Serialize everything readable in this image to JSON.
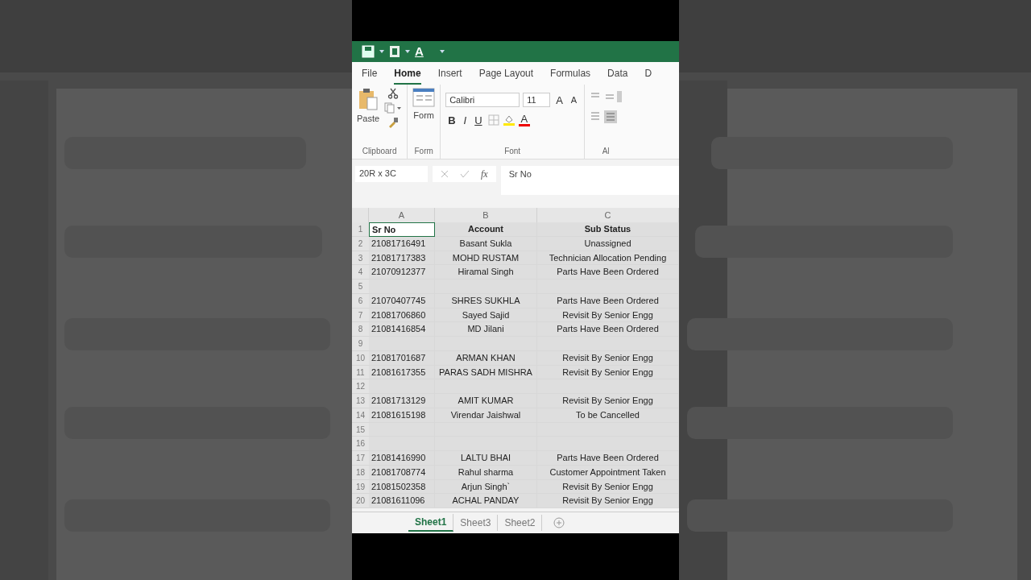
{
  "quick_access": {
    "text_icon": "A"
  },
  "ribbon_tabs": [
    {
      "label": "File",
      "selected": false
    },
    {
      "label": "Home",
      "selected": true
    },
    {
      "label": "Insert",
      "selected": false
    },
    {
      "label": "Page Layout",
      "selected": false
    },
    {
      "label": "Formulas",
      "selected": false
    },
    {
      "label": "Data",
      "selected": false
    },
    {
      "label": "D",
      "selected": false
    }
  ],
  "ribbon": {
    "clipboard": {
      "paste": "Paste",
      "label": "Clipboard"
    },
    "form": {
      "button": "Form",
      "label": "Form"
    },
    "font": {
      "name": "Calibri",
      "size": "11",
      "grow": "A",
      "shrink": "A",
      "bold": "B",
      "italic": "I",
      "underline": "U",
      "color_letter": "A",
      "label": "Font"
    },
    "alignment": {
      "label": "Al"
    }
  },
  "formula_bar": {
    "name_box": "20R x 3C",
    "function_label": "fx",
    "value": "Sr No"
  },
  "columns": [
    "A",
    "B",
    "C"
  ],
  "rows": [
    {
      "number": "1",
      "selected": true,
      "kind": "header",
      "cells": [
        {
          "text": "Sr No",
          "selected": true
        },
        {
          "text": "Account",
          "selected": false
        },
        {
          "text": "Sub Status",
          "selected": false
        }
      ]
    },
    {
      "number": "2",
      "selected": true,
      "kind": "data",
      "cells": [
        {
          "text": "21081716491",
          "selected": false
        },
        {
          "text": "Basant Sukla",
          "selected": false
        },
        {
          "text": "Unassigned",
          "selected": false
        }
      ]
    },
    {
      "number": "3",
      "selected": true,
      "kind": "data",
      "cells": [
        {
          "text": "21081717383",
          "selected": false
        },
        {
          "text": "MOHD RUSTAM",
          "selected": false
        },
        {
          "text": "Technician Allocation Pending",
          "selected": false
        }
      ]
    },
    {
      "number": "4",
      "selected": true,
      "kind": "data",
      "cells": [
        {
          "text": "21070912377",
          "selected": false
        },
        {
          "text": "Hiramal Singh",
          "selected": false
        },
        {
          "text": "Parts Have Been Ordered",
          "selected": false
        }
      ]
    },
    {
      "number": "5",
      "selected": true,
      "kind": "data",
      "cells": []
    },
    {
      "number": "6",
      "selected": true,
      "kind": "data",
      "cells": [
        {
          "text": "21070407745",
          "selected": false
        },
        {
          "text": "SHRES SUKHLA",
          "selected": false
        },
        {
          "text": "Parts Have Been Ordered",
          "selected": false
        }
      ]
    },
    {
      "number": "7",
      "selected": true,
      "kind": "data",
      "cells": [
        {
          "text": "21081706860",
          "selected": false
        },
        {
          "text": "Sayed Sajid",
          "selected": false
        },
        {
          "text": "Revisit By Senior Engg",
          "selected": false
        }
      ]
    },
    {
      "number": "8",
      "selected": true,
      "kind": "data",
      "cells": [
        {
          "text": "21081416854",
          "selected": false
        },
        {
          "text": "MD Jilani",
          "selected": false
        },
        {
          "text": "Parts Have Been Ordered",
          "selected": false
        }
      ]
    },
    {
      "number": "9",
      "selected": true,
      "kind": "data",
      "cells": []
    },
    {
      "number": "10",
      "selected": true,
      "kind": "data",
      "cells": [
        {
          "text": "21081701687",
          "selected": false
        },
        {
          "text": "ARMAN KHAN",
          "selected": false
        },
        {
          "text": "Revisit By Senior Engg",
          "selected": false
        }
      ]
    },
    {
      "number": "11",
      "selected": true,
      "kind": "data",
      "cells": [
        {
          "text": "21081617355",
          "selected": false
        },
        {
          "text": "PARAS SADH MISHRA",
          "selected": false
        },
        {
          "text": "Revisit By Senior Engg",
          "selected": false
        }
      ]
    },
    {
      "number": "12",
      "selected": true,
      "kind": "data",
      "cells": []
    },
    {
      "number": "13",
      "selected": true,
      "kind": "data",
      "cells": [
        {
          "text": "21081713129",
          "selected": false
        },
        {
          "text": "AMIT KUMAR",
          "selected": false
        },
        {
          "text": "Revisit By Senior Engg",
          "selected": false
        }
      ]
    },
    {
      "number": "14",
      "selected": true,
      "kind": "data",
      "cells": [
        {
          "text": "21081615198",
          "selected": false
        },
        {
          "text": "Virendar Jaishwal",
          "selected": false
        },
        {
          "text": "To be Cancelled",
          "selected": false
        }
      ]
    },
    {
      "number": "15",
      "selected": true,
      "kind": "data",
      "cells": []
    },
    {
      "number": "16",
      "selected": true,
      "kind": "data",
      "cells": []
    },
    {
      "number": "17",
      "selected": true,
      "kind": "data",
      "cells": [
        {
          "text": "21081416990",
          "selected": false
        },
        {
          "text": "LALTU BHAI",
          "selected": false
        },
        {
          "text": "Parts Have Been Ordered",
          "selected": false
        }
      ]
    },
    {
      "number": "18",
      "selected": true,
      "kind": "data",
      "cells": [
        {
          "text": "21081708774",
          "selected": false
        },
        {
          "text": "Rahul sharma",
          "selected": false
        },
        {
          "text": "Customer Appointment Taken",
          "selected": false
        }
      ]
    },
    {
      "number": "19",
      "selected": true,
      "kind": "data",
      "cells": [
        {
          "text": "21081502358",
          "selected": false
        },
        {
          "text": "Arjun Singh`",
          "selected": false
        },
        {
          "text": "Revisit By Senior Engg",
          "selected": false
        }
      ]
    },
    {
      "number": "20",
      "selected": true,
      "kind": "data",
      "cells": [
        {
          "text": "21081611096",
          "selected": false
        },
        {
          "text": "ACHAL PANDAY",
          "selected": false
        },
        {
          "text": "Revisit By Senior Engg",
          "selected": false
        }
      ]
    }
  ],
  "sheet_tabs": [
    {
      "label": "Sheet1",
      "selected": true
    },
    {
      "label": "Sheet3",
      "selected": false
    },
    {
      "label": "Sheet2",
      "selected": false
    }
  ]
}
